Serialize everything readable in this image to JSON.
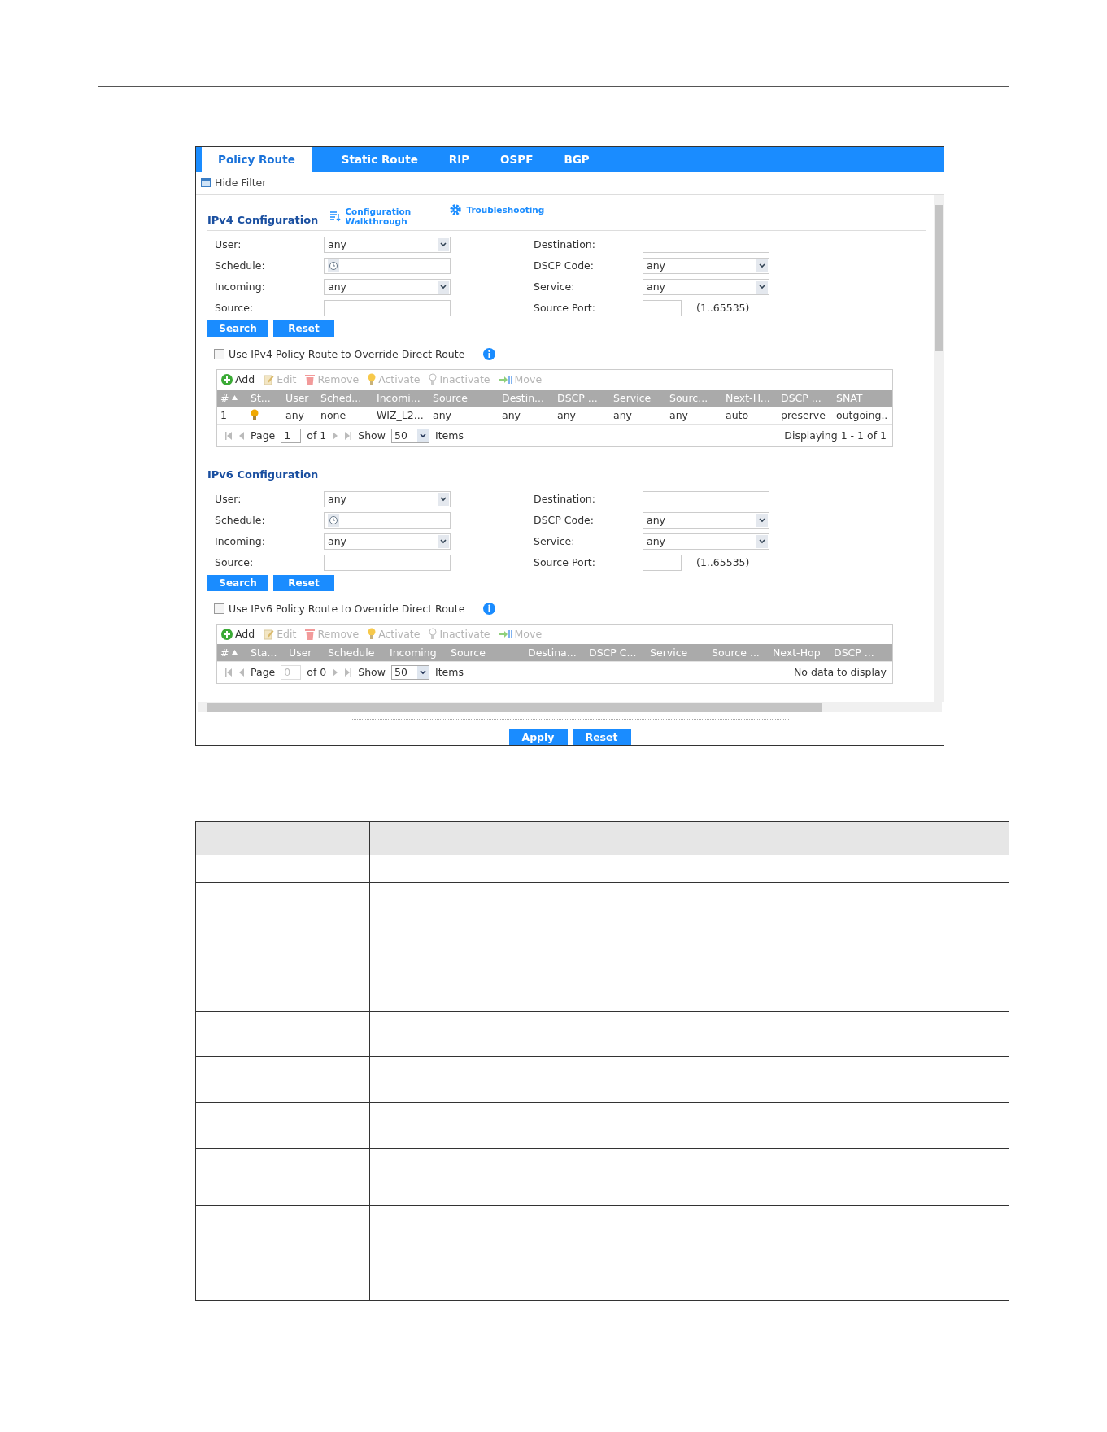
{
  "tabs": [
    {
      "label": "Policy Route",
      "selected": true
    },
    {
      "label": "Static Route",
      "selected": false
    },
    {
      "label": "RIP",
      "selected": false
    },
    {
      "label": "OSPF",
      "selected": false
    },
    {
      "label": "BGP",
      "selected": false
    }
  ],
  "filter_toggle": "Hide Filter",
  "sections": [
    {
      "title": "IPv4 Configuration",
      "links": [
        {
          "kind": "walkthrough",
          "label": "Configuration Walkthrough"
        },
        {
          "kind": "troubleshooting",
          "label": "Troubleshooting"
        }
      ],
      "filters_left": [
        {
          "label": "User:",
          "kind": "select",
          "value": "any"
        },
        {
          "label": "Schedule:",
          "kind": "schedule"
        },
        {
          "label": "Incoming:",
          "kind": "select",
          "value": "any"
        },
        {
          "label": "Source:",
          "kind": "text"
        }
      ],
      "filters_right": [
        {
          "label": "Destination:",
          "kind": "text"
        },
        {
          "label": "DSCP Code:",
          "kind": "select",
          "value": "any"
        },
        {
          "label": "Service:",
          "kind": "select",
          "value": "any"
        },
        {
          "label": "Source Port:",
          "kind": "port",
          "hint": "(1..65535)"
        }
      ],
      "buttons": [
        "Search",
        "Reset"
      ],
      "override": {
        "label": "Use IPv4 Policy Route to Override Direct Route",
        "checked": false
      },
      "toolbar": [
        {
          "kind": "add",
          "label": "Add",
          "disabled": false
        },
        {
          "kind": "edit",
          "label": "Edit",
          "disabled": true
        },
        {
          "kind": "remove",
          "label": "Remove",
          "disabled": true
        },
        {
          "kind": "activate",
          "label": "Activate",
          "disabled": true
        },
        {
          "kind": "inactivate",
          "label": "Inactivate",
          "disabled": true
        },
        {
          "kind": "move",
          "label": "Move",
          "disabled": true
        }
      ],
      "columns": [
        "#",
        "St...",
        "User",
        "Sched...",
        "Incomi...",
        "Source",
        "Destin...",
        "DSCP ...",
        "Service",
        "Sourc...",
        "Next-H...",
        "DSCP ...",
        "SNAT"
      ],
      "rows": [
        {
          "active": true,
          "cells": [
            "1",
            "",
            "any",
            "none",
            "WIZ_L2...",
            "any",
            "any",
            "any",
            "any",
            "any",
            "auto",
            "preserve",
            "outgoing.."
          ]
        }
      ],
      "pager": {
        "page_label": "Page",
        "page": "1",
        "of": "of 1",
        "show": "Show",
        "size": "50",
        "items": "Items",
        "disabled": false,
        "display": "Displaying 1 - 1 of 1"
      }
    },
    {
      "title": "IPv6 Configuration",
      "filters_left": [
        {
          "label": "User:",
          "kind": "select",
          "value": "any"
        },
        {
          "label": "Schedule:",
          "kind": "schedule"
        },
        {
          "label": "Incoming:",
          "kind": "select",
          "value": "any"
        },
        {
          "label": "Source:",
          "kind": "text"
        }
      ],
      "filters_right": [
        {
          "label": "Destination:",
          "kind": "text"
        },
        {
          "label": "DSCP Code:",
          "kind": "select",
          "value": "any"
        },
        {
          "label": "Service:",
          "kind": "select",
          "value": "any"
        },
        {
          "label": "Source Port:",
          "kind": "port",
          "hint": "(1..65535)"
        }
      ],
      "buttons": [
        "Search",
        "Reset"
      ],
      "override": {
        "label": "Use IPv6 Policy Route to Override Direct Route",
        "checked": false
      },
      "toolbar": [
        {
          "kind": "add",
          "label": "Add",
          "disabled": false
        },
        {
          "kind": "edit",
          "label": "Edit",
          "disabled": true
        },
        {
          "kind": "remove",
          "label": "Remove",
          "disabled": true
        },
        {
          "kind": "activate",
          "label": "Activate",
          "disabled": true
        },
        {
          "kind": "inactivate",
          "label": "Inactivate",
          "disabled": true
        },
        {
          "kind": "move",
          "label": "Move",
          "disabled": true
        }
      ],
      "columns": [
        "#",
        "Sta...",
        "User",
        "Schedule",
        "Incoming",
        "Source",
        "Destina...",
        "DSCP C...",
        "Service",
        "Source ...",
        "Next-Hop",
        "DSCP ..."
      ],
      "pager": {
        "page_label": "Page",
        "page": "0",
        "of": "of 0",
        "show": "Show",
        "size": "50",
        "items": "Items",
        "disabled": true,
        "display": "No data to display"
      }
    }
  ],
  "footer_buttons": [
    "Apply",
    "Reset"
  ]
}
